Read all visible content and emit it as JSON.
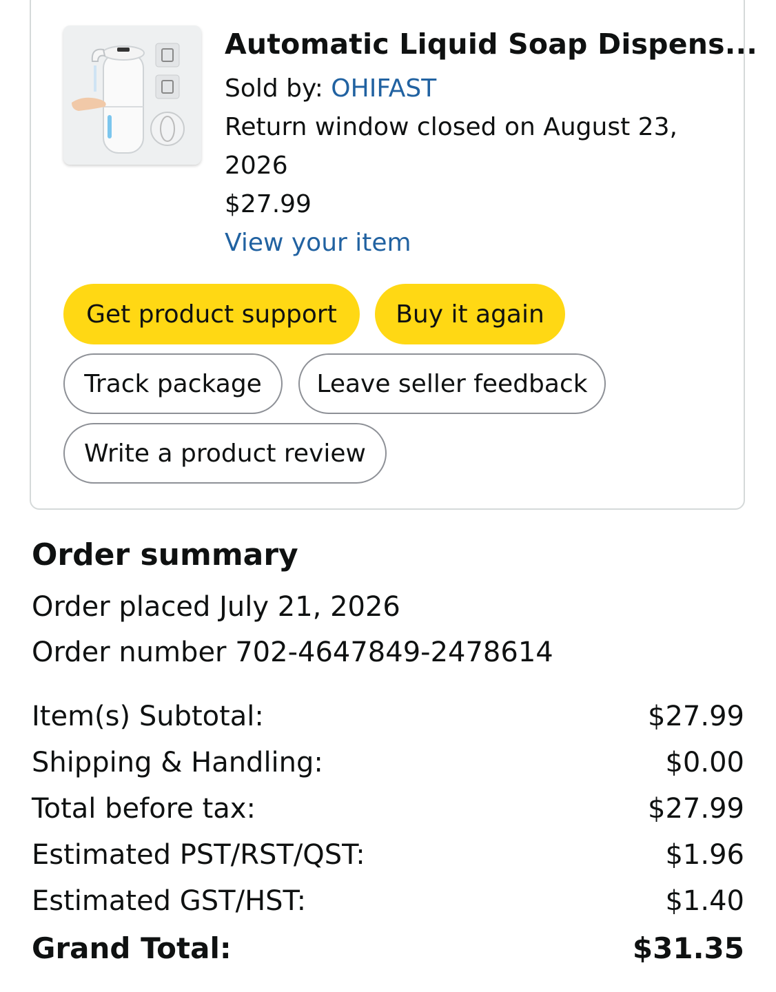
{
  "product": {
    "image_icon": "soap-dispenser-image",
    "title": "Automatic Liquid Soap Dispens...",
    "sold_by_label": "Sold by:",
    "seller": "OHIFAST",
    "return_line1": "Return window closed on August 23,",
    "return_line2": "2026",
    "price": "$27.99",
    "view_item": "View your item"
  },
  "actions": {
    "get_support": "Get product support",
    "buy_again": "Buy it again",
    "track_package": "Track package",
    "seller_feedback": "Leave seller feedback",
    "write_review": "Write a product review"
  },
  "summary": {
    "heading": "Order summary",
    "order_placed": "Order placed July 21, 2026",
    "order_number": "Order number 702-4647849-2478614",
    "rows": [
      {
        "label": "Item(s) Subtotal:",
        "value": "$27.99"
      },
      {
        "label": "Shipping & Handling:",
        "value": "$0.00"
      },
      {
        "label": "Total before tax:",
        "value": "$27.99"
      },
      {
        "label": "Estimated PST/RST/QST:",
        "value": "$1.96"
      },
      {
        "label": "Estimated GST/HST:",
        "value": "$1.40"
      }
    ],
    "grand_total_label": "Grand Total:",
    "grand_total_value": "$31.35"
  },
  "colors": {
    "link": "#2162a1",
    "primary_button": "#ffd814",
    "outline_border": "#8d9096",
    "card_border": "#d5d9d9"
  }
}
